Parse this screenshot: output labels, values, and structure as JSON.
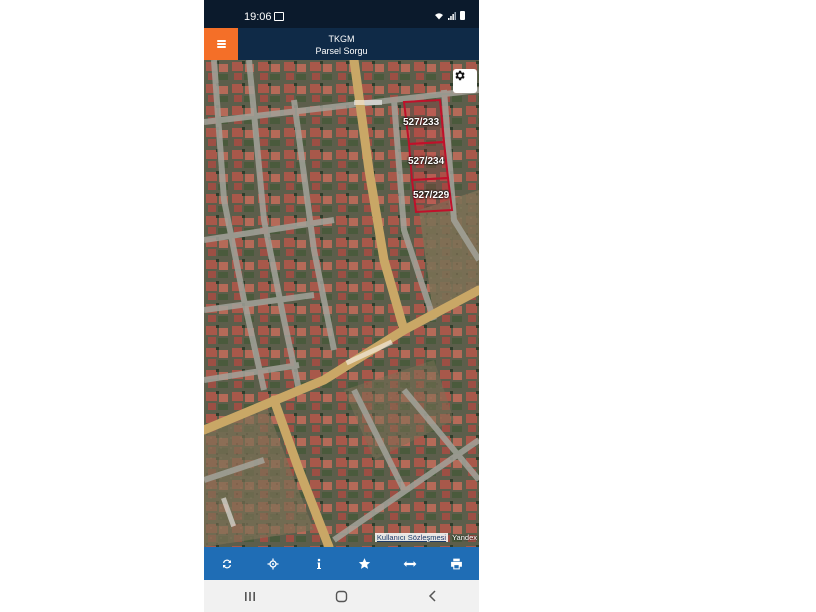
{
  "status_bar": {
    "time": "19:06",
    "icons": [
      "image-notification-icon",
      "wifi-icon",
      "signal-icon",
      "battery-icon"
    ]
  },
  "app_bar": {
    "title": "TKGM",
    "subtitle": "Parsel Sorgu",
    "menu_icon": "hamburger-menu-icon",
    "accent_color": "#f46f28",
    "background_color": "#0f2a47"
  },
  "map": {
    "settings_icon": "gear-icon",
    "parcels": [
      {
        "label": "527/233"
      },
      {
        "label": "527/234"
      },
      {
        "label": "527/229"
      }
    ],
    "parcel_outline_color": "#c0102a",
    "attribution": {
      "user_agreement": "Kullanıcı Sözleşmesi",
      "provider": "Yandex"
    }
  },
  "toolbar": {
    "background_color": "#1f6db5",
    "tools": [
      {
        "name": "refresh-icon"
      },
      {
        "name": "locate-icon"
      },
      {
        "name": "info-icon"
      },
      {
        "name": "star-icon"
      },
      {
        "name": "measure-icon"
      },
      {
        "name": "print-icon"
      }
    ]
  },
  "nav_bar": {
    "buttons": [
      {
        "name": "recent-apps-icon"
      },
      {
        "name": "home-icon"
      },
      {
        "name": "back-icon"
      }
    ]
  }
}
